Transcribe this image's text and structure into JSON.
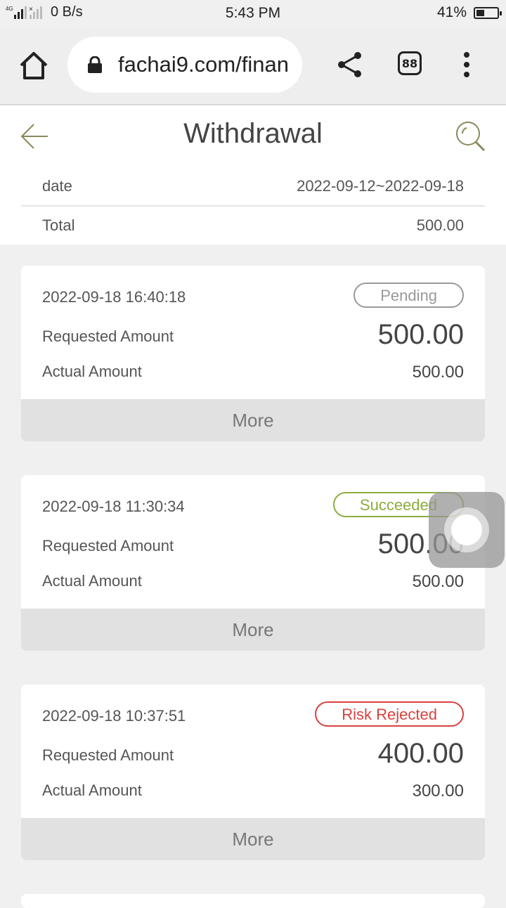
{
  "status_bar": {
    "network": "4G",
    "speed": "0 B/s",
    "time": "5:43 PM",
    "battery": "41%",
    "battery_level": 0.41
  },
  "browser": {
    "url": "fachai9.com/finan",
    "tab_count": "88"
  },
  "header": {
    "title": "Withdrawal"
  },
  "summary": {
    "date_label": "date",
    "date_value": "2022-09-12~2022-09-18",
    "total_label": "Total",
    "total_value": "500.00"
  },
  "records": [
    {
      "time": "2022-09-18 16:40:18",
      "status": "Pending",
      "requested_label": "Requested Amount",
      "requested_value": "500.00",
      "actual_label": "Actual Amount",
      "actual_value": "500.00",
      "more_label": "More"
    },
    {
      "time": "2022-09-18 11:30:34",
      "status": "Succeeded",
      "requested_label": "Requested Amount",
      "requested_value": "500.00",
      "actual_label": "Actual Amount",
      "actual_value": "500.00",
      "more_label": "More"
    },
    {
      "time": "2022-09-18 10:37:51",
      "status": "Risk Rejected",
      "requested_label": "Requested Amount",
      "requested_value": "400.00",
      "actual_label": "Actual Amount",
      "actual_value": "300.00",
      "more_label": "More"
    }
  ],
  "colors": {
    "pending": "#999999",
    "succeeded": "#8cad3c",
    "rejected": "#d9413f"
  }
}
